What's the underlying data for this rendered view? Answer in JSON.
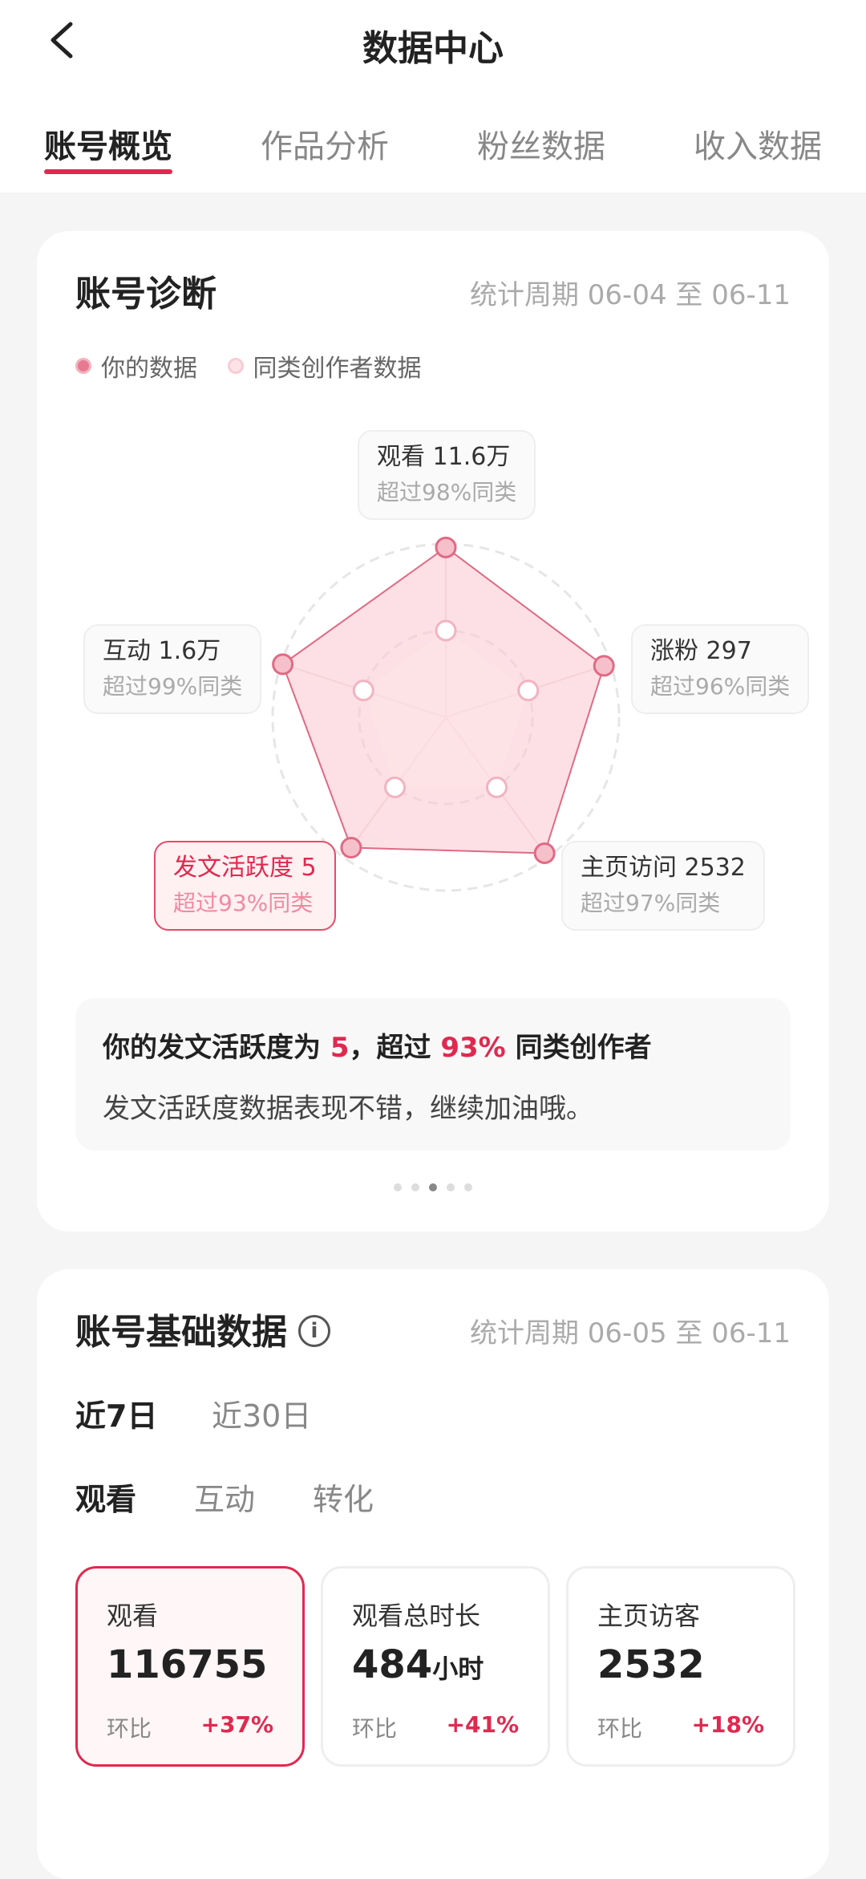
{
  "header": {
    "title": "数据中心",
    "tabs": [
      {
        "label": "账号概览"
      },
      {
        "label": "作品分析"
      },
      {
        "label": "粉丝数据"
      },
      {
        "label": "收入数据"
      }
    ]
  },
  "diagnosis": {
    "title": "账号诊断",
    "period": "统计周期 06-04 至 06-11",
    "legend": {
      "mine": "你的数据",
      "peer": "同类创作者数据"
    },
    "colors": {
      "accent": "#e0294f",
      "mine_fill": "#f9c6d0",
      "peer_fill": "#fde3e8"
    },
    "axes": [
      {
        "label": "观看 11.6万",
        "sub": "超过98%同类",
        "mine_score": 0.98,
        "peer_score": 0.5
      },
      {
        "label": "涨粉 297",
        "sub": "超过96%同类",
        "mine_score": 0.96,
        "peer_score": 0.5
      },
      {
        "label": "主页访问 2532",
        "sub": "超过97%同类",
        "mine_score": 0.97,
        "peer_score": 0.5
      },
      {
        "label": "发文活跃度 5",
        "sub": "超过93%同类",
        "mine_score": 0.93,
        "peer_score": 0.5
      },
      {
        "label": "互动 1.6万",
        "sub": "超过99%同类",
        "mine_score": 0.99,
        "peer_score": 0.5
      }
    ],
    "highlight_axis": "发文活跃度 5",
    "insight": {
      "prefix": "你的发文活跃度为 ",
      "value": "5",
      "middle": "，超过 ",
      "percent": "93%",
      "suffix": " 同类创作者",
      "desc": "发文活跃度数据表现不错，继续加油哦。"
    },
    "pager": {
      "count": 5,
      "active": 2
    }
  },
  "basic": {
    "title": "账号基础数据",
    "period": "统计周期 06-05 至 06-11",
    "ranges": [
      "近7日",
      "近30日"
    ],
    "metric_tabs": [
      "观看",
      "互动",
      "转化"
    ],
    "stats": [
      {
        "label": "观看",
        "value": "116755",
        "unit": "",
        "cmp": "环比",
        "pct": "+37%"
      },
      {
        "label": "观看总时长",
        "value": "484",
        "unit": "小时",
        "cmp": "环比",
        "pct": "+41%"
      },
      {
        "label": "主页访客",
        "value": "2532",
        "unit": "",
        "cmp": "环比",
        "pct": "+18%"
      }
    ]
  }
}
